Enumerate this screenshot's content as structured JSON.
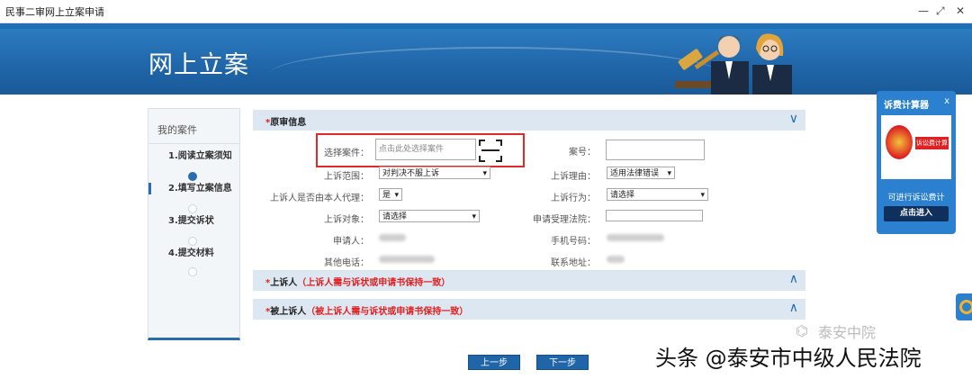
{
  "window": {
    "title": "民事二审网上立案申请",
    "min": "—",
    "restore": "⤢",
    "close": "✕"
  },
  "banner": {
    "heading": "网上立案"
  },
  "sidebar": {
    "title": "我的案件",
    "steps": [
      {
        "label": "1.阅读立案须知"
      },
      {
        "label": "2.填写立案信息"
      },
      {
        "label": "3.提交诉状"
      },
      {
        "label": "4.提交材料"
      }
    ]
  },
  "sections": {
    "original": {
      "required": "*",
      "title": "原审信息",
      "chev": "∨"
    },
    "appellant": {
      "required": "*",
      "title": "上诉人",
      "note": "（上诉人需与诉状或申请书保持一致）",
      "chev": "∧"
    },
    "appellee": {
      "required": "*",
      "title": "被上诉人",
      "note": "（被上诉人需与诉状或申请书保持一致）",
      "chev": "∧"
    }
  },
  "form": {
    "select_case": {
      "label": "选择案件：",
      "placeholder": "点击此处选择案件"
    },
    "case_no": {
      "label": "案号：",
      "value": ""
    },
    "appeal_scope": {
      "label": "上诉范围：",
      "value": "对判决不服上诉"
    },
    "appeal_reason": {
      "label": "上诉理由：",
      "value": "适用法律错误"
    },
    "by_agent": {
      "label": "上诉人是否由本人代理：",
      "value": "是"
    },
    "appeal_act": {
      "label": "上诉行为：",
      "value": "请选择"
    },
    "appeal_target": {
      "label": "上诉对象：",
      "value": "请选择"
    },
    "court": {
      "label": "申请受理法院：",
      "value": ""
    },
    "applicant": {
      "label": "申请人："
    },
    "phone": {
      "label": "手机号码："
    },
    "other_phone": {
      "label": "其他电话："
    },
    "address": {
      "label": "联系地址："
    }
  },
  "buttons": {
    "prev": "上一步",
    "next": "下一步"
  },
  "calculator": {
    "title": "诉费计算器",
    "close": "x",
    "image_text": "诉讼费计算器",
    "subtitle": "可进行诉讼费计",
    "enter": "点击进入"
  },
  "watermarks": {
    "wechat": "泰安中院",
    "credit": "头条 @泰安市中级人民法院"
  },
  "colors": {
    "accent": "#1f6fb8",
    "required": "#e02020",
    "section_bg": "#dce7f2",
    "button": "#1f65a8"
  }
}
